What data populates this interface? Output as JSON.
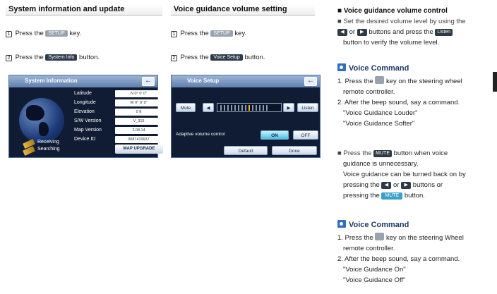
{
  "left": {
    "header": "System information and update",
    "step1": {
      "num": "1",
      "pre": "Press the",
      "key": "SETUP",
      "post": "key."
    },
    "step2": {
      "num": "2",
      "pre": "Press the",
      "key": "System Info",
      "post": "button."
    },
    "screen": {
      "title": "System Information",
      "back": "←",
      "rows": [
        {
          "label": "Latitude",
          "value": "N  0° 0' 0\""
        },
        {
          "label": "Longitude",
          "value": "W  0° 0' 0\""
        },
        {
          "label": "Elevation",
          "value": "0 ft"
        },
        {
          "label": "S/W Version",
          "value": "V_315"
        },
        {
          "label": "Map Version",
          "value": "2.08.14"
        },
        {
          "label": "Device ID",
          "value": "0087419937"
        }
      ],
      "map_upgrade": "MAP UPGRADE",
      "gps": [
        "Receiving",
        "Searching"
      ]
    }
  },
  "middle": {
    "header": "Voice guidance volume setting",
    "step1": {
      "num": "1",
      "pre": "Press the",
      "key": "SETUP",
      "post": "key."
    },
    "step2": {
      "num": "2",
      "pre": "Press the",
      "key": "Voice Setup",
      "post": "button."
    },
    "screen": {
      "title": "Voice Setup",
      "back": "←",
      "mute": "Mute",
      "left_arrow": "◀",
      "right_arrow": "▶",
      "listen": "Listen",
      "volume_ticks": 14,
      "volume_level": 8,
      "adaptive_label": "Adaptive volume control",
      "on": "ON",
      "off": "OFF",
      "default": "Default",
      "done": "Done"
    }
  },
  "right": {
    "control_title": "■ Voice guidance volume control",
    "control_text_1": "■ Set the desired volume level by using the",
    "control_text_2a": "or",
    "control_text_2b": "buttons and press the",
    "listen_key": "Listen",
    "control_text_3": "button to verify the volume level.",
    "arrow_left": "◀",
    "arrow_right": "▶",
    "vc1": {
      "title": "Voice Command",
      "l1a": "1. Press the",
      "l1b": "key on the steering wheel",
      "l2": "remote controller.",
      "l3": "2. After the beep sound, say a command.",
      "l4": "\"Voice Guidance Louder\"",
      "l5": "\"Voice Guidance Softer\""
    },
    "mute_para": {
      "l1a": "■ Press the",
      "key": "MUTE",
      "l1b": "button when voice",
      "l2": "guidance is unnecessary.",
      "l3": "Voice guidance can be turned back on by",
      "l4a": "pressing the",
      "l4b": "or",
      "l4c": "buttons or",
      "l5a": "pressing the",
      "key2": "MUTE",
      "l5b": "button."
    },
    "vc2": {
      "title": "Voice Command",
      "l1a": "1. Press the",
      "l1b": "key on the steering Wheel",
      "l2": "remote controller.",
      "l3": "2. After the beep sound, say a command.",
      "l4": "\"Voice Guidance On\"",
      "l5": "\"Voice Guidance Off\""
    }
  }
}
